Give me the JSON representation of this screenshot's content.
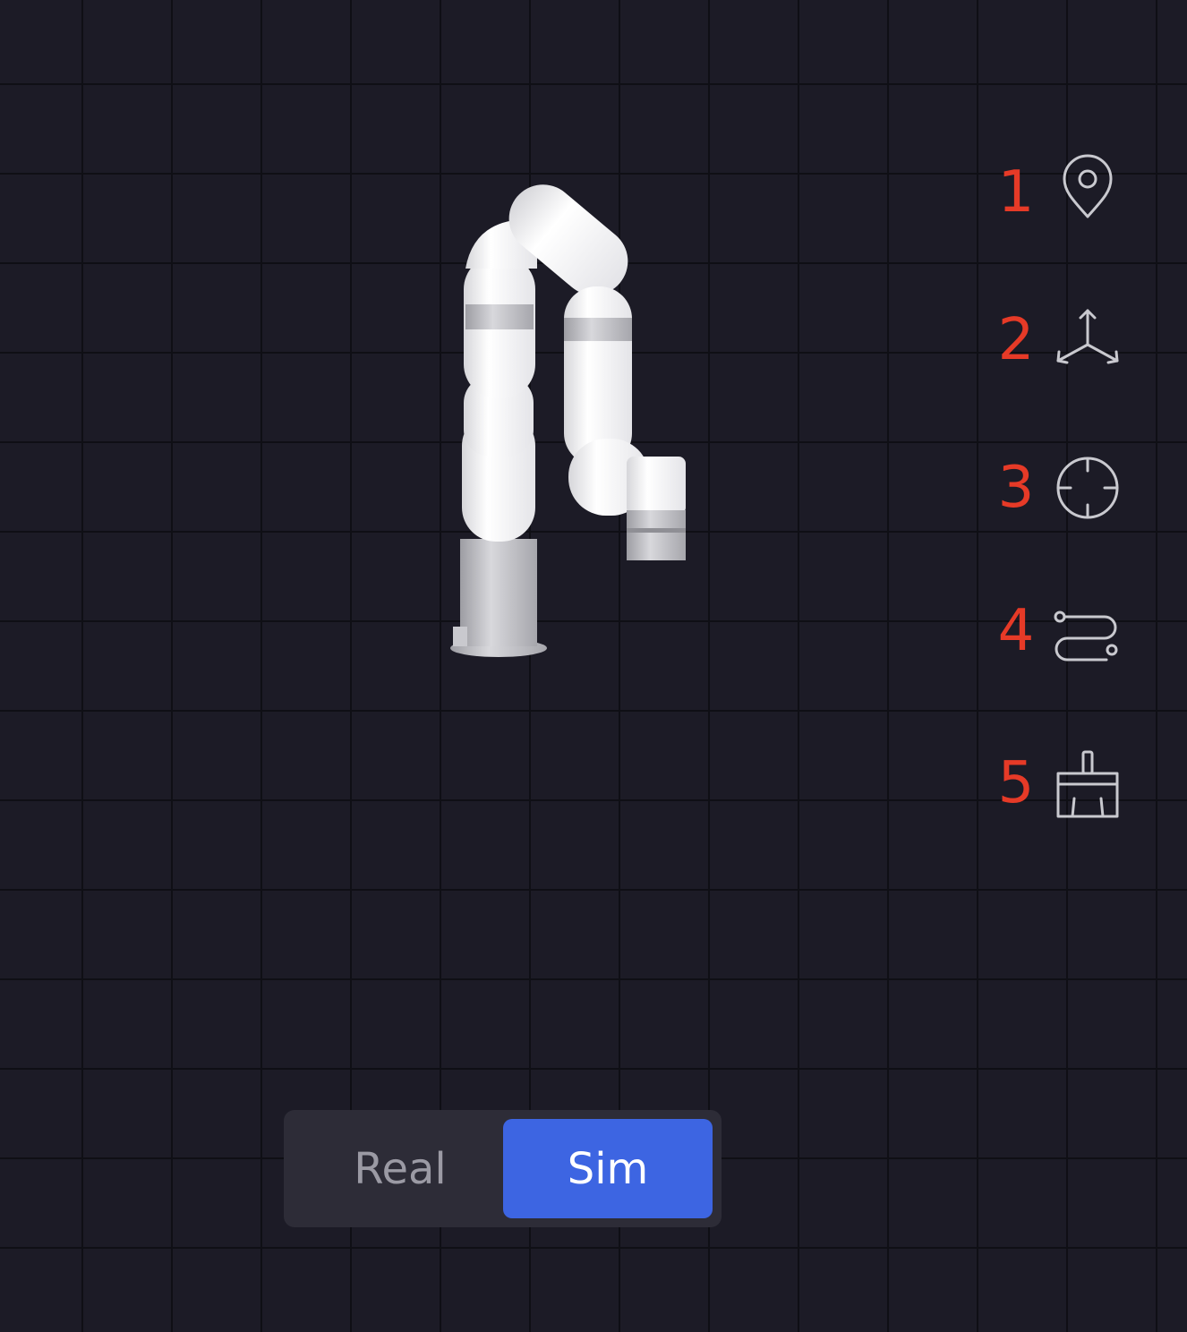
{
  "viewport": {
    "background_color": "#1c1b26",
    "grid_line_color": "#0f0f15"
  },
  "robot": {
    "name": "robot-arm-model",
    "link_color": "#f4f4f6",
    "ring_color": "#a9a9b0"
  },
  "toolbar": {
    "items": [
      {
        "number": "1",
        "icon": "location-pin-icon"
      },
      {
        "number": "2",
        "icon": "axes-3d-icon"
      },
      {
        "number": "3",
        "icon": "crosshair-icon"
      },
      {
        "number": "4",
        "icon": "path-route-icon"
      },
      {
        "number": "5",
        "icon": "clear-brush-icon"
      }
    ],
    "number_color": "#e63a27",
    "icon_color": "#c9c9cf"
  },
  "mode_toggle": {
    "real_label": "Real",
    "sim_label": "Sim",
    "selected": "Sim",
    "active_color": "#3d65e2"
  }
}
